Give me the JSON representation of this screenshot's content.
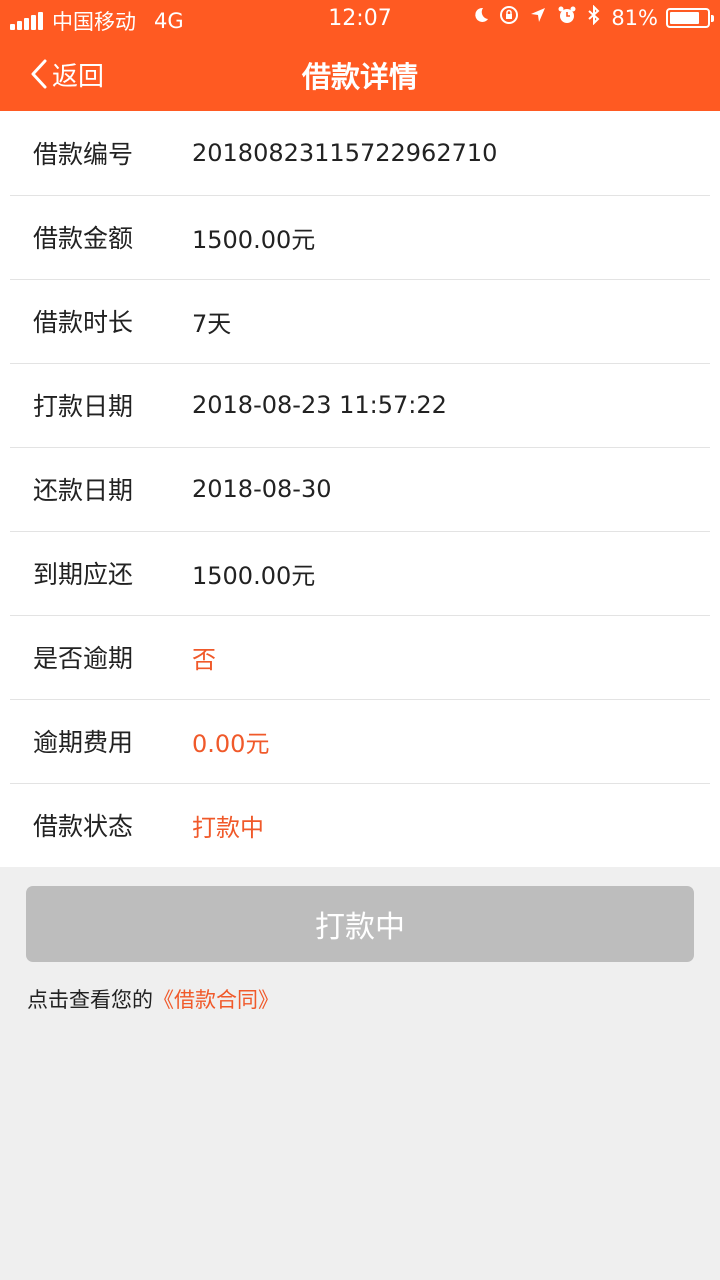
{
  "status_bar": {
    "carrier": "中国移动",
    "network": "4G",
    "time": "12:07",
    "battery_percent": "81%",
    "battery_level": 0.81,
    "icons": [
      "moon-icon",
      "rotation-lock-icon",
      "location-icon",
      "alarm-icon",
      "bluetooth-icon"
    ]
  },
  "nav": {
    "back_label": "返回",
    "title": "借款详情"
  },
  "details": [
    {
      "label": "借款编号",
      "value": "2018082311572296271​0",
      "accent": false
    },
    {
      "label": "借款金额",
      "value": "1500.00元",
      "accent": false
    },
    {
      "label": "借款时长",
      "value": "7天",
      "accent": false
    },
    {
      "label": "打款日期",
      "value": "2018-08-23 11:57:22",
      "accent": false
    },
    {
      "label": "还款日期",
      "value": "2018-08-30",
      "accent": false
    },
    {
      "label": "到期应还",
      "value": "1500.00元",
      "accent": false
    },
    {
      "label": "是否逾期",
      "value": "否",
      "accent": true
    },
    {
      "label": "逾期费用",
      "value": "0.00元",
      "accent": true
    },
    {
      "label": "借款状态",
      "value": "打款中",
      "accent": true
    }
  ],
  "action_button": {
    "label": "打款中"
  },
  "contract": {
    "prefix": "点击查看您的",
    "link_text": "《借款合同》"
  },
  "colors": {
    "brand": "#ff5a22",
    "accent_text": "#f0592a",
    "disabled_button": "#bdbdbd",
    "background": "#efefef"
  }
}
